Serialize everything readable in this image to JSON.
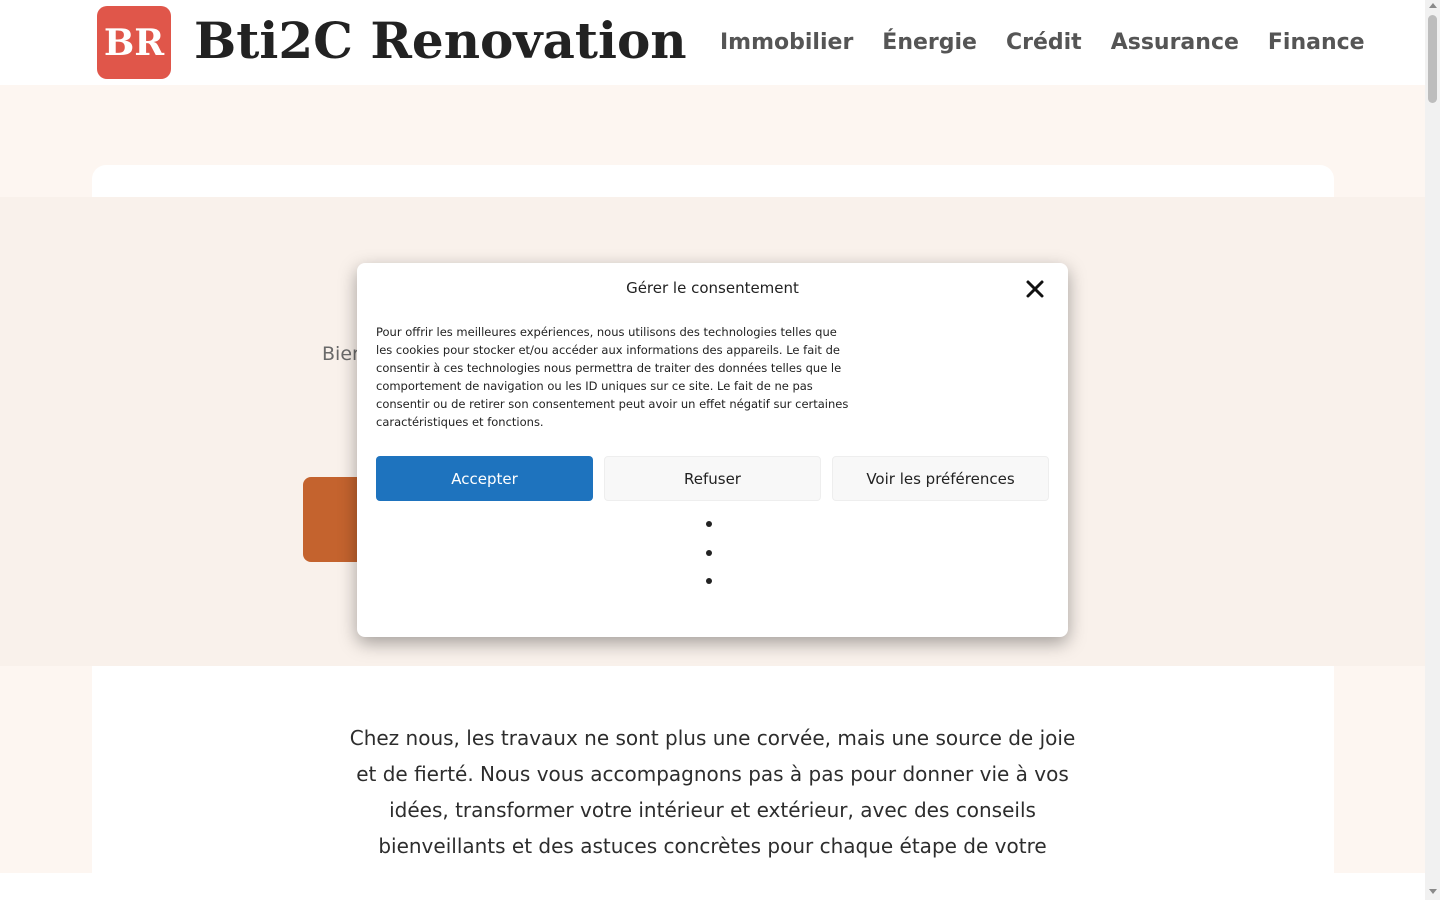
{
  "header": {
    "logo_initials": "BR",
    "site_title": "Bti2C Renovation",
    "nav": [
      "Immobilier",
      "Énergie",
      "Crédit",
      "Assurance",
      "Finance"
    ]
  },
  "hero": {
    "partial_text": "Bier"
  },
  "intro": {
    "text": "Chez nous, les travaux ne sont plus une corvée, mais une source de joie et de fierté. Nous vous accompagnons pas à pas pour donner vie à vos idées, transformer votre intérieur et extérieur, avec des conseils bienveillants et des astuces concrètes pour chaque étape de votre aventure maison."
  },
  "consent": {
    "title": "Gérer le consentement",
    "body": "Pour offrir les meilleures expériences, nous utilisons des technologies telles que les cookies pour stocker et/ou accéder aux informations des appareils. Le fait de consentir à ces technologies nous permettra de traiter des données telles que le comportement de navigation ou les ID uniques sur ce site. Le fait de ne pas consentir ou de retirer son consentement peut avoir un effet négatif sur certaines caractéristiques et fonctions.",
    "accept_label": "Accepter",
    "refuse_label": "Refuser",
    "prefs_label": "Voir les préférences"
  },
  "colors": {
    "logo_bg": "#e0564a",
    "accept_button": "#1e73be",
    "hero_cta": "#c4632e",
    "page_bg": "#fdf6f1"
  },
  "icons": {
    "close": "close-icon",
    "scroll_up": "arrow-up-icon",
    "scroll_down": "arrow-down-icon"
  }
}
